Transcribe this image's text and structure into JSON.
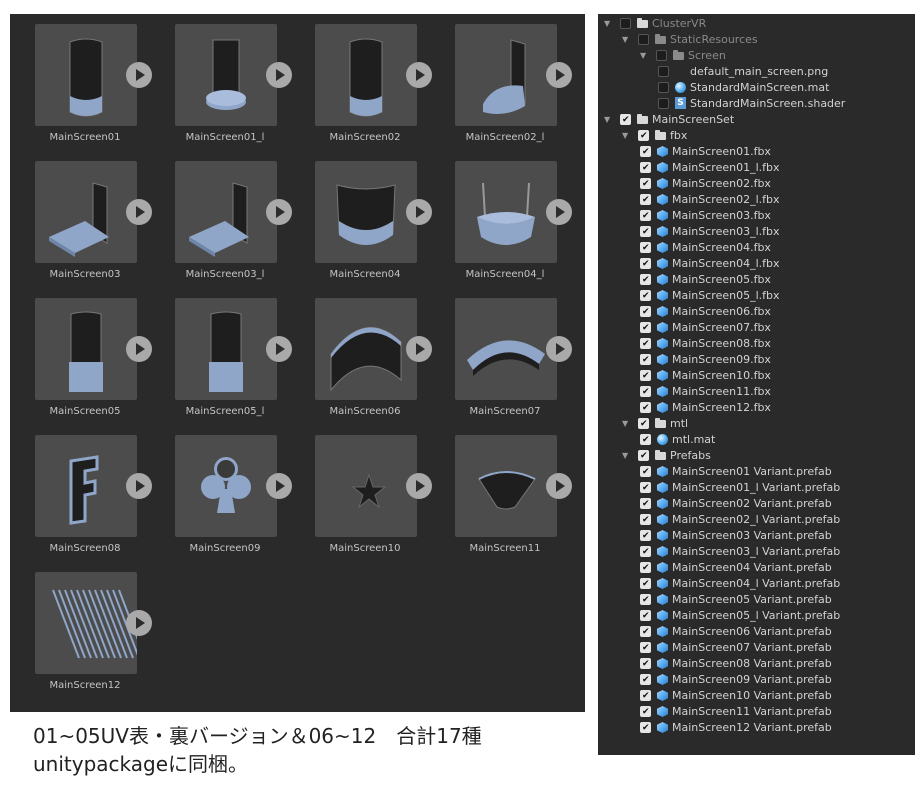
{
  "grid": {
    "items": [
      {
        "label": "MainScreen01",
        "shape": "tall-base"
      },
      {
        "label": "MainScreen01_l",
        "shape": "tall-disc"
      },
      {
        "label": "MainScreen02",
        "shape": "tall-base"
      },
      {
        "label": "MainScreen02_l",
        "shape": "tall-quarter"
      },
      {
        "label": "MainScreen03",
        "shape": "corner-stage"
      },
      {
        "label": "MainScreen03_l",
        "shape": "corner-stage"
      },
      {
        "label": "MainScreen04",
        "shape": "bowl"
      },
      {
        "label": "MainScreen04_l",
        "shape": "bowl-open"
      },
      {
        "label": "MainScreen05",
        "shape": "tower-box"
      },
      {
        "label": "MainScreen05_l",
        "shape": "tower-box"
      },
      {
        "label": "MainScreen06",
        "shape": "arch"
      },
      {
        "label": "MainScreen07",
        "shape": "arch-flat"
      },
      {
        "label": "MainScreen08",
        "shape": "glyph-f"
      },
      {
        "label": "MainScreen09",
        "shape": "club"
      },
      {
        "label": "MainScreen10",
        "shape": "star"
      },
      {
        "label": "MainScreen11",
        "shape": "fan"
      },
      {
        "label": "MainScreen12",
        "shape": "stripes"
      }
    ]
  },
  "caption": {
    "line1": "01~05UV表・裏バージョン＆06~12　合計17種",
    "line2": "unitypackageに同梱。"
  },
  "tree": {
    "rows": [
      {
        "depth": 0,
        "arrow": "down",
        "checked": false,
        "icon": "folder",
        "icon_gray": false,
        "label": "ClusterVR",
        "dim": true
      },
      {
        "depth": 1,
        "arrow": "down",
        "checked": false,
        "icon": "folder",
        "icon_gray": true,
        "label": "StaticResources",
        "dim": true
      },
      {
        "depth": 2,
        "arrow": "down",
        "checked": false,
        "icon": "folder",
        "icon_gray": true,
        "label": "Screen",
        "dim": true
      },
      {
        "depth": 3,
        "arrow": "",
        "checked": false,
        "icon": "img",
        "label": "default_main_screen.png",
        "dim": false
      },
      {
        "depth": 3,
        "arrow": "",
        "checked": false,
        "icon": "mat",
        "label": "StandardMainScreen.mat",
        "dim": false
      },
      {
        "depth": 3,
        "arrow": "",
        "checked": false,
        "icon": "shader",
        "label": "StandardMainScreen.shader",
        "dim": false
      },
      {
        "depth": 0,
        "arrow": "down",
        "checked": true,
        "icon": "folder",
        "label": "MainScreenSet",
        "dim": false
      },
      {
        "depth": 1,
        "arrow": "down",
        "checked": true,
        "icon": "folder",
        "label": "fbx",
        "dim": false
      },
      {
        "depth": 2,
        "arrow": "",
        "checked": true,
        "icon": "mesh",
        "label": "MainScreen01.fbx"
      },
      {
        "depth": 2,
        "arrow": "",
        "checked": true,
        "icon": "mesh",
        "label": "MainScreen01_l.fbx"
      },
      {
        "depth": 2,
        "arrow": "",
        "checked": true,
        "icon": "mesh",
        "label": "MainScreen02.fbx"
      },
      {
        "depth": 2,
        "arrow": "",
        "checked": true,
        "icon": "mesh",
        "label": "MainScreen02_l.fbx"
      },
      {
        "depth": 2,
        "arrow": "",
        "checked": true,
        "icon": "mesh",
        "label": "MainScreen03.fbx"
      },
      {
        "depth": 2,
        "arrow": "",
        "checked": true,
        "icon": "mesh",
        "label": "MainScreen03_l.fbx"
      },
      {
        "depth": 2,
        "arrow": "",
        "checked": true,
        "icon": "mesh",
        "label": "MainScreen04.fbx"
      },
      {
        "depth": 2,
        "arrow": "",
        "checked": true,
        "icon": "mesh",
        "label": "MainScreen04_l.fbx"
      },
      {
        "depth": 2,
        "arrow": "",
        "checked": true,
        "icon": "mesh",
        "label": "MainScreen05.fbx"
      },
      {
        "depth": 2,
        "arrow": "",
        "checked": true,
        "icon": "mesh",
        "label": "MainScreen05_l.fbx"
      },
      {
        "depth": 2,
        "arrow": "",
        "checked": true,
        "icon": "mesh",
        "label": "MainScreen06.fbx"
      },
      {
        "depth": 2,
        "arrow": "",
        "checked": true,
        "icon": "mesh",
        "label": "MainScreen07.fbx"
      },
      {
        "depth": 2,
        "arrow": "",
        "checked": true,
        "icon": "mesh",
        "label": "MainScreen08.fbx"
      },
      {
        "depth": 2,
        "arrow": "",
        "checked": true,
        "icon": "mesh",
        "label": "MainScreen09.fbx"
      },
      {
        "depth": 2,
        "arrow": "",
        "checked": true,
        "icon": "mesh",
        "label": "MainScreen10.fbx"
      },
      {
        "depth": 2,
        "arrow": "",
        "checked": true,
        "icon": "mesh",
        "label": "MainScreen11.fbx"
      },
      {
        "depth": 2,
        "arrow": "",
        "checked": true,
        "icon": "mesh",
        "label": "MainScreen12.fbx"
      },
      {
        "depth": 1,
        "arrow": "down",
        "checked": true,
        "icon": "folder",
        "label": "mtl"
      },
      {
        "depth": 2,
        "arrow": "",
        "checked": true,
        "icon": "mat",
        "label": "mtl.mat"
      },
      {
        "depth": 1,
        "arrow": "down",
        "checked": true,
        "icon": "folder",
        "label": "Prefabs"
      },
      {
        "depth": 2,
        "arrow": "",
        "checked": true,
        "icon": "mesh",
        "label": "MainScreen01 Variant.prefab"
      },
      {
        "depth": 2,
        "arrow": "",
        "checked": true,
        "icon": "mesh",
        "label": "MainScreen01_l Variant.prefab"
      },
      {
        "depth": 2,
        "arrow": "",
        "checked": true,
        "icon": "mesh",
        "label": "MainScreen02 Variant.prefab"
      },
      {
        "depth": 2,
        "arrow": "",
        "checked": true,
        "icon": "mesh",
        "label": "MainScreen02_l Variant.prefab"
      },
      {
        "depth": 2,
        "arrow": "",
        "checked": true,
        "icon": "mesh",
        "label": "MainScreen03 Variant.prefab"
      },
      {
        "depth": 2,
        "arrow": "",
        "checked": true,
        "icon": "mesh",
        "label": "MainScreen03_l Variant.prefab"
      },
      {
        "depth": 2,
        "arrow": "",
        "checked": true,
        "icon": "mesh",
        "label": "MainScreen04 Variant.prefab"
      },
      {
        "depth": 2,
        "arrow": "",
        "checked": true,
        "icon": "mesh",
        "label": "MainScreen04_l Variant.prefab"
      },
      {
        "depth": 2,
        "arrow": "",
        "checked": true,
        "icon": "mesh",
        "label": "MainScreen05 Variant.prefab"
      },
      {
        "depth": 2,
        "arrow": "",
        "checked": true,
        "icon": "mesh",
        "label": "MainScreen05_l Variant.prefab"
      },
      {
        "depth": 2,
        "arrow": "",
        "checked": true,
        "icon": "mesh",
        "label": "MainScreen06 Variant.prefab"
      },
      {
        "depth": 2,
        "arrow": "",
        "checked": true,
        "icon": "mesh",
        "label": "MainScreen07 Variant.prefab"
      },
      {
        "depth": 2,
        "arrow": "",
        "checked": true,
        "icon": "mesh",
        "label": "MainScreen08 Variant.prefab"
      },
      {
        "depth": 2,
        "arrow": "",
        "checked": true,
        "icon": "mesh",
        "label": "MainScreen09 Variant.prefab"
      },
      {
        "depth": 2,
        "arrow": "",
        "checked": true,
        "icon": "mesh",
        "label": "MainScreen10 Variant.prefab"
      },
      {
        "depth": 2,
        "arrow": "",
        "checked": true,
        "icon": "mesh",
        "label": "MainScreen11 Variant.prefab"
      },
      {
        "depth": 2,
        "arrow": "",
        "checked": true,
        "icon": "mesh",
        "label": "MainScreen12 Variant.prefab"
      }
    ]
  },
  "colors": {
    "panel_bg": "#2a2a2a",
    "thumb_bg": "#4c4c4c",
    "model_blue": "#8fa6c8",
    "model_dark": "#1e1e1e"
  }
}
